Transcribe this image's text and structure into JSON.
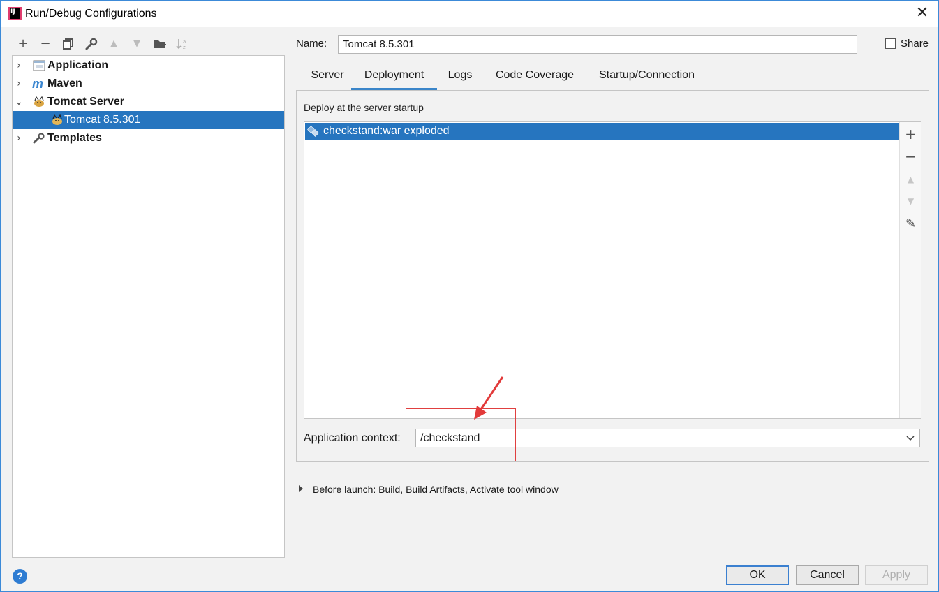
{
  "window": {
    "title": "Run/Debug Configurations",
    "close_glyph": "✕"
  },
  "toolbar": {
    "add": "+",
    "remove": "−",
    "copy": "⧉",
    "edit_defaults": "🔧",
    "move_up": "▲",
    "move_down": "▼",
    "new_folder": "▣",
    "sort": "↓"
  },
  "tree": {
    "items": [
      {
        "label": "Application",
        "icon": "application-icon",
        "expanded": false
      },
      {
        "label": "Maven",
        "icon": "maven-icon",
        "expanded": false
      },
      {
        "label": "Tomcat Server",
        "icon": "tomcat-icon",
        "expanded": true
      },
      {
        "label": "Tomcat 8.5.301",
        "icon": "tomcat-icon",
        "selected": true
      },
      {
        "label": "Templates",
        "icon": "wrench-icon",
        "expanded": false
      }
    ]
  },
  "name_field": {
    "label": "Name:",
    "value": "Tomcat 8.5.301"
  },
  "share": {
    "label": "Share",
    "checked": false
  },
  "tabs": [
    {
      "label": "Server",
      "active": false
    },
    {
      "label": "Deployment",
      "active": true
    },
    {
      "label": "Logs",
      "active": false
    },
    {
      "label": "Code Coverage",
      "active": false
    },
    {
      "label": "Startup/Connection",
      "active": false
    }
  ],
  "deployment": {
    "group_title": "Deploy at the server startup",
    "items": [
      {
        "label": "checkstand:war exploded",
        "icon": "artifact-icon",
        "selected": true
      }
    ],
    "side_buttons": {
      "add": "+",
      "remove": "−",
      "up": "▲",
      "down": "▼",
      "edit": "✎"
    }
  },
  "app_context": {
    "label": "Application context:",
    "value": "/checkstand"
  },
  "before_launch": {
    "label": "Before launch: Build, Build Artifacts, Activate tool window"
  },
  "footer": {
    "help": "?",
    "ok": "OK",
    "cancel": "Cancel",
    "apply": "Apply"
  },
  "colors": {
    "selection": "#2675bf",
    "annotation": "#e04040",
    "window_border": "#3c8ad8"
  }
}
